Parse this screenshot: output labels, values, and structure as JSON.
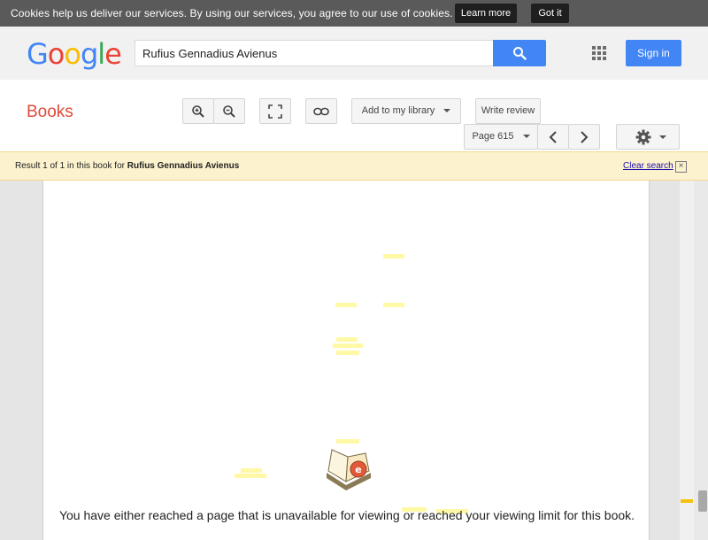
{
  "cookie_bar": {
    "text": "Cookies help us deliver our services. By using our services, you agree to our use of cookies.",
    "learn_more": "Learn more",
    "got_it": "Got it"
  },
  "header": {
    "logo_letters": [
      "G",
      "o",
      "o",
      "g",
      "l",
      "e"
    ],
    "search_value": "Rufius Gennadius Avienus",
    "sign_in": "Sign in"
  },
  "toolbar": {
    "books_title": "Books",
    "add_to_library": "Add to my library",
    "write_review": "Write review",
    "page_select": "Page 615"
  },
  "result_bar": {
    "prefix": "Result 1 of 1 in this book for",
    "query": "Rufius Gennadius Avienus",
    "clear_search": "Clear search"
  },
  "viewer": {
    "unavailable_message": "You have either reached a page that is unavailable for viewing or reached your viewing limit for this book."
  },
  "colors": {
    "cookie_bg": "#5a5a5a",
    "accent_blue": "#4285f4",
    "books_red": "#dd4b39",
    "result_bg": "#fcf2cd",
    "highlight": "#fff9a6"
  },
  "icons": [
    "search-icon",
    "apps-grid-icon",
    "zoom-in-icon",
    "zoom-out-icon",
    "fullscreen-icon",
    "link-icon",
    "prev-page-icon",
    "next-page-icon",
    "gear-icon",
    "book-icon",
    "close-icon"
  ]
}
